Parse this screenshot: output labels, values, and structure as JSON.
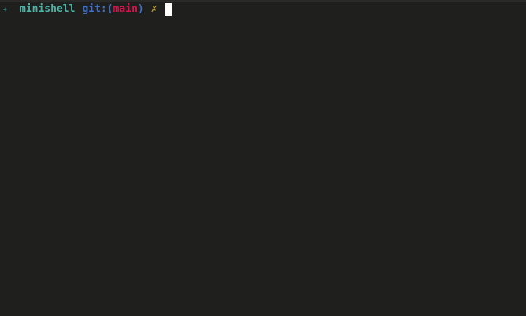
{
  "terminal": {
    "prompt": {
      "arrow_icon": "prompt-arrow-icon",
      "directory": "minishell",
      "git_prefix": "git:",
      "paren_open": "(",
      "branch": "main",
      "paren_close": ")",
      "dirty_marker": "✗",
      "input_value": ""
    }
  },
  "colors": {
    "background": "#1f1f1d",
    "arrow": "#4db3a7",
    "directory": "#4db3a7",
    "git_label": "#3e6fc2",
    "branch": "#d4134f",
    "dirty_marker": "#b99a34",
    "cursor": "#ffffff"
  }
}
